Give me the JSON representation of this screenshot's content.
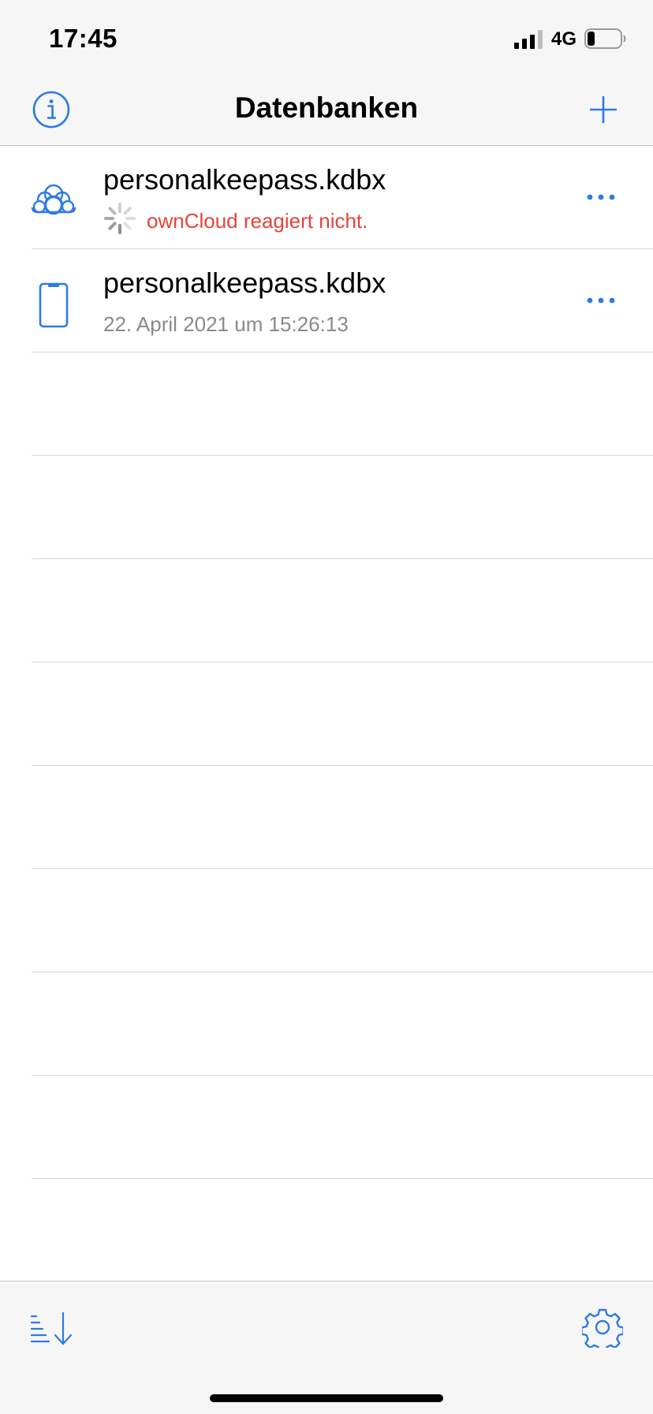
{
  "status_bar": {
    "time": "17:45",
    "network": "4G"
  },
  "nav": {
    "title": "Datenbanken",
    "left_icon": "info-icon",
    "right_icon": "plus-icon"
  },
  "databases": [
    {
      "name": "personalkeepass.kdbx",
      "status": "ownCloud reagiert nicht.",
      "icon": "owncloud-icon",
      "state": "loading-error"
    },
    {
      "name": "personalkeepass.kdbx",
      "status": "22. April 2021 um 15:26:13",
      "icon": "iphone-icon",
      "state": "local"
    }
  ],
  "toolbar": {
    "left_icon": "sort-icon",
    "right_icon": "gear-icon"
  },
  "colors": {
    "accent": "#2f7ae5",
    "error": "#e5443a",
    "secondary_text": "#8a8a8e",
    "bar_background": "#f6f6f6"
  }
}
